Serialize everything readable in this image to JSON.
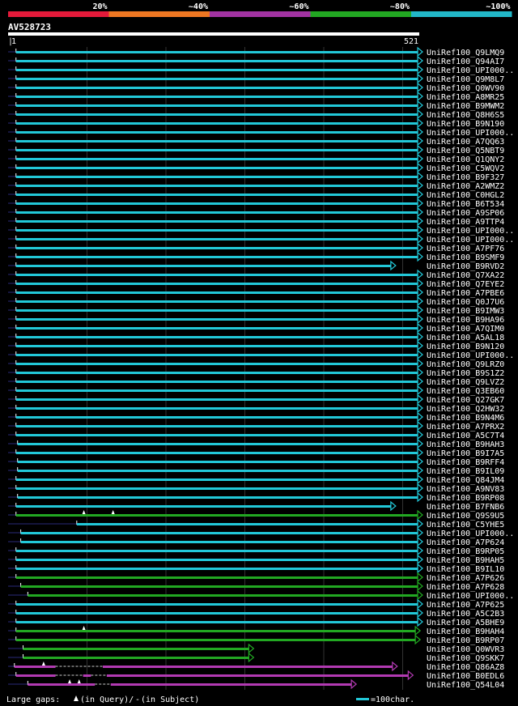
{
  "scale": {
    "labels": [
      "20%",
      "~40%",
      "~60%",
      "~80%",
      "~100%"
    ],
    "colors": [
      "#e41a3a",
      "#ee7722",
      "#a233a2",
      "#22a822",
      "#22b8c8"
    ]
  },
  "query": {
    "name": "AV528723",
    "start": "1",
    "end": "521",
    "length": 521
  },
  "colors": {
    "cyan": "#22c8d8",
    "green": "#22a822",
    "magenta": "#b23ab2",
    "gap_line": "#2a2a7a",
    "grid": "#333333"
  },
  "hits": [
    {
      "label": "UniRef100_Q9LMQ9",
      "qs": 10,
      "qe": 519,
      "color": "cyan"
    },
    {
      "label": "UniRef100_Q94AI7",
      "qs": 10,
      "qe": 519,
      "color": "cyan"
    },
    {
      "label": "UniRef100_UPI000..",
      "qs": 10,
      "qe": 519,
      "color": "cyan"
    },
    {
      "label": "UniRef100_Q9M8L7",
      "qs": 10,
      "qe": 519,
      "color": "cyan"
    },
    {
      "label": "UniRef100_Q0WV90",
      "qs": 10,
      "qe": 519,
      "color": "cyan"
    },
    {
      "label": "UniRef100_A8MR25",
      "qs": 10,
      "qe": 519,
      "color": "cyan"
    },
    {
      "label": "UniRef100_B9MWM2",
      "qs": 10,
      "qe": 519,
      "color": "cyan"
    },
    {
      "label": "UniRef100_Q8H6S5",
      "qs": 10,
      "qe": 519,
      "color": "cyan"
    },
    {
      "label": "UniRef100_B9N190",
      "qs": 10,
      "qe": 519,
      "color": "cyan"
    },
    {
      "label": "UniRef100_UPI000..",
      "qs": 10,
      "qe": 519,
      "color": "cyan"
    },
    {
      "label": "UniRef100_A7QQ63",
      "qs": 10,
      "qe": 519,
      "color": "cyan"
    },
    {
      "label": "UniRef100_Q5NBT9",
      "qs": 10,
      "qe": 519,
      "color": "cyan"
    },
    {
      "label": "UniRef100_Q1QNY2",
      "qs": 10,
      "qe": 519,
      "color": "cyan"
    },
    {
      "label": "UniRef100_C5WQV2",
      "qs": 10,
      "qe": 519,
      "color": "cyan"
    },
    {
      "label": "UniRef100_B9F327",
      "qs": 10,
      "qe": 519,
      "color": "cyan"
    },
    {
      "label": "UniRef100_A2WMZ2",
      "qs": 10,
      "qe": 519,
      "color": "cyan"
    },
    {
      "label": "UniRef100_C0HGL2",
      "qs": 10,
      "qe": 519,
      "color": "cyan"
    },
    {
      "label": "UniRef100_B6T534",
      "qs": 10,
      "qe": 519,
      "color": "cyan"
    },
    {
      "label": "UniRef100_A9SP06",
      "qs": 10,
      "qe": 519,
      "color": "cyan"
    },
    {
      "label": "UniRef100_A9TTP4",
      "qs": 10,
      "qe": 519,
      "color": "cyan"
    },
    {
      "label": "UniRef100_UPI000..",
      "qs": 10,
      "qe": 519,
      "color": "cyan"
    },
    {
      "label": "UniRef100_UPI000..",
      "qs": 10,
      "qe": 519,
      "color": "cyan"
    },
    {
      "label": "UniRef100_A7PF76",
      "qs": 10,
      "qe": 519,
      "color": "cyan"
    },
    {
      "label": "UniRef100_B9SMF9",
      "qs": 10,
      "qe": 519,
      "color": "cyan"
    },
    {
      "label": "UniRef100_B9RVD2",
      "qs": 10,
      "qe": 485,
      "color": "cyan"
    },
    {
      "label": "UniRef100_Q7XA22",
      "qs": 10,
      "qe": 519,
      "color": "cyan"
    },
    {
      "label": "UniRef100_Q7EYE2",
      "qs": 10,
      "qe": 519,
      "color": "cyan"
    },
    {
      "label": "UniRef100_A7PBE6",
      "qs": 10,
      "qe": 519,
      "color": "cyan"
    },
    {
      "label": "UniRef100_Q0J7U6",
      "qs": 10,
      "qe": 519,
      "color": "cyan"
    },
    {
      "label": "UniRef100_B9IMW3",
      "qs": 10,
      "qe": 519,
      "color": "cyan"
    },
    {
      "label": "UniRef100_B9HA96",
      "qs": 10,
      "qe": 519,
      "color": "cyan"
    },
    {
      "label": "UniRef100_A7QIM0",
      "qs": 10,
      "qe": 519,
      "color": "cyan"
    },
    {
      "label": "UniRef100_A5AL18",
      "qs": 10,
      "qe": 519,
      "color": "cyan"
    },
    {
      "label": "UniRef100_B9N120",
      "qs": 10,
      "qe": 519,
      "color": "cyan"
    },
    {
      "label": "UniRef100_UPI000..",
      "qs": 10,
      "qe": 519,
      "color": "cyan"
    },
    {
      "label": "UniRef100_Q9LRZ0",
      "qs": 10,
      "qe": 519,
      "color": "cyan"
    },
    {
      "label": "UniRef100_B9S1Z2",
      "qs": 10,
      "qe": 519,
      "color": "cyan"
    },
    {
      "label": "UniRef100_Q9LVZ2",
      "qs": 10,
      "qe": 519,
      "color": "cyan"
    },
    {
      "label": "UniRef100_Q3EB60",
      "qs": 10,
      "qe": 519,
      "color": "cyan"
    },
    {
      "label": "UniRef100_Q27GK7",
      "qs": 10,
      "qe": 519,
      "color": "cyan"
    },
    {
      "label": "UniRef100_Q2HW32",
      "qs": 10,
      "qe": 519,
      "color": "cyan"
    },
    {
      "label": "UniRef100_B9N4M6",
      "qs": 10,
      "qe": 519,
      "color": "cyan"
    },
    {
      "label": "UniRef100_A7PRX2",
      "qs": 10,
      "qe": 519,
      "color": "cyan"
    },
    {
      "label": "UniRef100_A5C7T4",
      "qs": 10,
      "qe": 519,
      "color": "cyan"
    },
    {
      "label": "UniRef100_B9HAH3",
      "qs": 12,
      "qe": 519,
      "color": "cyan"
    },
    {
      "label": "UniRef100_B9I7A5",
      "qs": 10,
      "qe": 519,
      "color": "cyan"
    },
    {
      "label": "UniRef100_B9RFF4",
      "qs": 12,
      "qe": 519,
      "color": "cyan"
    },
    {
      "label": "UniRef100_B9IL09",
      "qs": 12,
      "qe": 519,
      "color": "cyan"
    },
    {
      "label": "UniRef100_Q84JM4",
      "qs": 10,
      "qe": 519,
      "color": "cyan"
    },
    {
      "label": "UniRef100_A9NV83",
      "qs": 10,
      "qe": 519,
      "color": "cyan"
    },
    {
      "label": "UniRef100_B9RP08",
      "qs": 12,
      "qe": 519,
      "color": "cyan"
    },
    {
      "label": "UniRef100_B7FNB6",
      "qs": 10,
      "qe": 485,
      "color": "cyan"
    },
    {
      "label": "UniRef100_Q9S9U5",
      "qs": 10,
      "qe": 519,
      "color": "green",
      "marks": [
        96,
        133
      ]
    },
    {
      "label": "UniRef100_C5YHE5",
      "qs": 87,
      "qe": 519,
      "color": "cyan"
    },
    {
      "label": "UniRef100_UPI000..",
      "qs": 16,
      "qe": 519,
      "color": "cyan"
    },
    {
      "label": "UniRef100_A7P624",
      "qs": 16,
      "qe": 519,
      "color": "cyan"
    },
    {
      "label": "UniRef100_B9RP05",
      "qs": 10,
      "qe": 519,
      "color": "cyan"
    },
    {
      "label": "UniRef100_B9HAH5",
      "qs": 10,
      "qe": 519,
      "color": "cyan"
    },
    {
      "label": "UniRef100_B9IL10",
      "qs": 10,
      "qe": 519,
      "color": "cyan"
    },
    {
      "label": "UniRef100_A7P626",
      "qs": 10,
      "qe": 519,
      "color": "green"
    },
    {
      "label": "UniRef100_A7P628",
      "qs": 16,
      "qe": 519,
      "color": "green"
    },
    {
      "label": "UniRef100_UPI000..",
      "qs": 25,
      "qe": 519,
      "color": "green"
    },
    {
      "label": "UniRef100_A7P625",
      "qs": 10,
      "qe": 519,
      "color": "cyan"
    },
    {
      "label": "UniRef100_A5C2B3",
      "qs": 10,
      "qe": 519,
      "color": "cyan"
    },
    {
      "label": "UniRef100_A5BHE9",
      "qs": 10,
      "qe": 519,
      "color": "cyan"
    },
    {
      "label": "UniRef100_B9HAH4",
      "qs": 10,
      "qe": 516,
      "color": "green",
      "marks": [
        96
      ]
    },
    {
      "label": "UniRef100_B9RP07",
      "qs": 10,
      "qe": 516,
      "color": "green"
    },
    {
      "label": "UniRef100_Q0WVR3",
      "qs": 19,
      "qe": 305,
      "color": "green"
    },
    {
      "label": "UniRef100_Q9SKK7",
      "qs": 19,
      "qe": 305,
      "color": "green"
    },
    {
      "label": "UniRef100_Q86AZ8",
      "qs": 8,
      "qe": 487,
      "color": "magenta",
      "marks": [
        45
      ],
      "gaps": [
        [
          60,
          120
        ]
      ]
    },
    {
      "label": "UniRef100_B0EDL6",
      "qs": 10,
      "qe": 507,
      "color": "magenta",
      "gaps": [
        [
          60,
          95
        ],
        [
          105,
          125
        ]
      ]
    },
    {
      "label": "UniRef100_Q54L04",
      "qs": 25,
      "qe": 435,
      "color": "magenta",
      "marks": [
        78,
        90
      ],
      "gaps": [
        [
          110,
          130
        ]
      ]
    }
  ],
  "legend": {
    "large_gaps": "Large gaps:",
    "in_query": "(in Query)/",
    "in_subject": "(in Subject)",
    "scale_text": "=100char."
  }
}
